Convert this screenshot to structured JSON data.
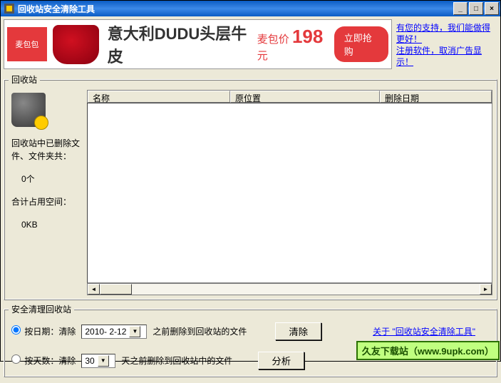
{
  "window": {
    "title": "回收站安全清除工具"
  },
  "ad": {
    "logo": "麦包包",
    "text": "意大利DUDU头层牛皮",
    "price_label": "麦包价",
    "price_num": "198",
    "price_unit": "元",
    "buy": "立即抢购",
    "link1": "有您的支持，我们能做得更好！",
    "link2": "注册软件，取消广告显示！"
  },
  "recycle": {
    "legend": "回收站",
    "cols": {
      "name": "名称",
      "loc": "原位置",
      "date": "删除日期"
    },
    "info1a": "回收站中已删除文",
    "info1b": "件、文件夹共：",
    "count": "0个",
    "info2": "合计占用空间：",
    "size": "0KB"
  },
  "clean": {
    "legend": "安全清理回收站",
    "by_date_label": "按日期：清除",
    "date_value": "2010- 2-12",
    "date_suffix": "之前删除到回收站的文件",
    "clear_btn": "清除",
    "by_days_label": "按天数：清除",
    "days_value": "30",
    "days_suffix": "天之前删除到回收站中的文件",
    "analyze_btn": "分析",
    "about": "关于 \"回收站安全清除工具\""
  },
  "watermark": "久友下载站（www.9upk.com）"
}
